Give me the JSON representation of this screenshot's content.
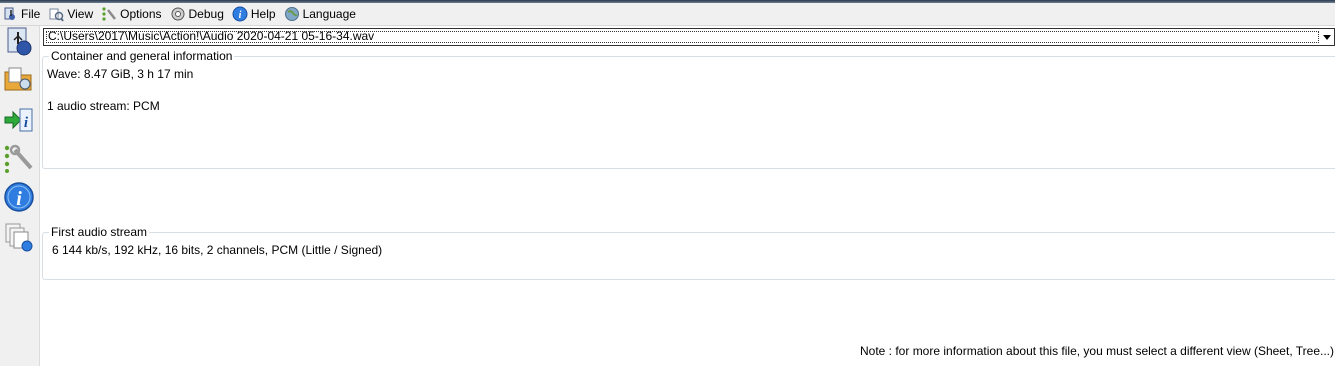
{
  "menu": {
    "items": [
      {
        "label": "File",
        "icon": "file-icon"
      },
      {
        "label": "View",
        "icon": "view-icon"
      },
      {
        "label": "Options",
        "icon": "options-icon"
      },
      {
        "label": "Debug",
        "icon": "debug-icon"
      },
      {
        "label": "Help",
        "icon": "help-icon"
      },
      {
        "label": "Language",
        "icon": "language-icon"
      }
    ]
  },
  "sidebar": {
    "buttons": [
      {
        "icon": "open-file-icon"
      },
      {
        "icon": "open-folder-icon"
      },
      {
        "icon": "export-info-icon"
      },
      {
        "icon": "preferences-icon"
      },
      {
        "icon": "about-icon"
      },
      {
        "icon": "web-update-icon"
      }
    ]
  },
  "file_selector": {
    "value": "C:\\Users\\2017\\Music\\Action!\\Audio 2020-04-21 05-16-34.wav"
  },
  "general": {
    "title": "Container and general information",
    "line1": "Wave: 8.47 GiB, 3 h 17 min",
    "line2": "1 audio stream: PCM"
  },
  "audio": {
    "title": "First audio stream",
    "line1": "6 144 kb/s, 192 kHz, 16 bits, 2 channels, PCM (Little / Signed)"
  },
  "note": "Note : for more information about this file, you must select a different view (Sheet, Tree...)",
  "colors": {
    "menu_bg": "#f0f0f0",
    "group_border": "#d5dfe5",
    "info_blue": "#1a6fd1"
  }
}
